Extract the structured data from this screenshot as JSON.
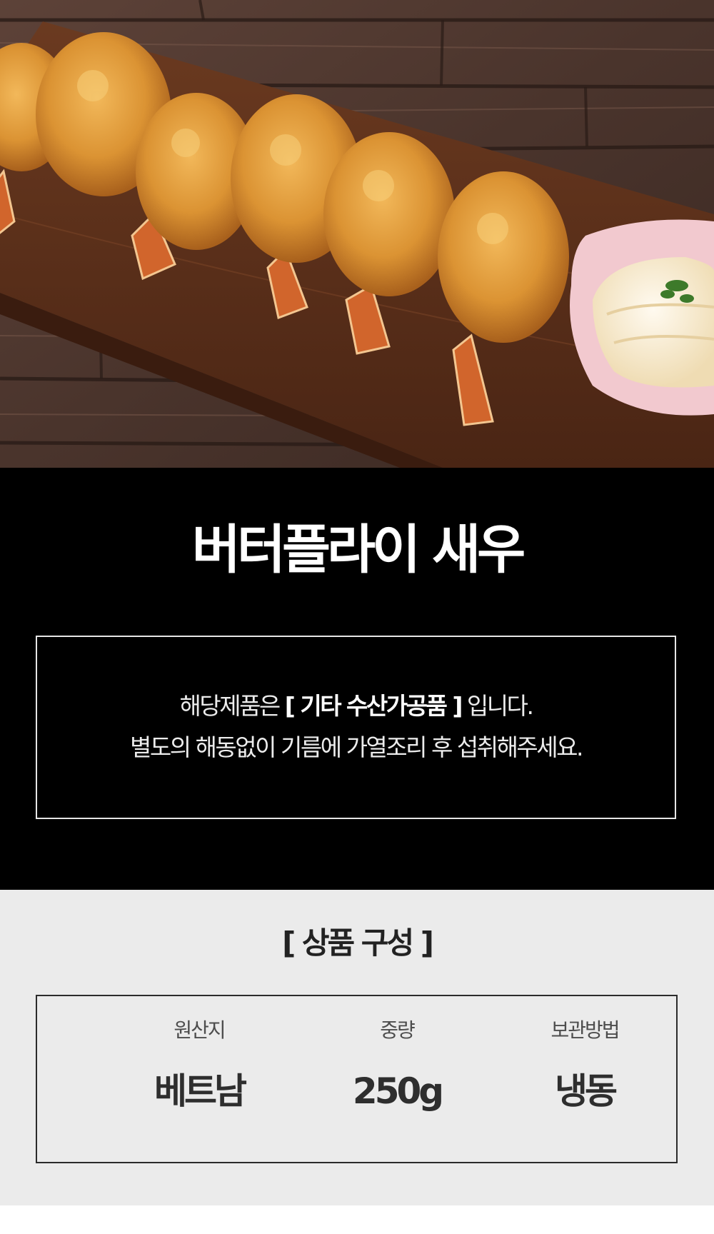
{
  "hero": {
    "image_name": "butterfly-shrimp-photo",
    "colors": {
      "wood_dark": "#3b2720",
      "board": "#5a2f1a",
      "fry": "#d9902e",
      "bowl": "#f2c9cf",
      "sauce": "#fbf1d8"
    }
  },
  "product": {
    "title": "버터플라이 새우"
  },
  "notice": {
    "line1_prefix": "해당제품은 ",
    "line1_bold": "[ 기타 수산가공품 ]",
    "line1_suffix": " 입니다.",
    "line2": "별도의 해동없이 기름에 가열조리 후 섭취해주세요."
  },
  "composition": {
    "title": "[ 상품 구성 ]",
    "items": [
      {
        "label": "원산지",
        "value": "베트남"
      },
      {
        "label": "중량",
        "value": "250g"
      },
      {
        "label": "보관방법",
        "value": "냉동"
      }
    ]
  }
}
